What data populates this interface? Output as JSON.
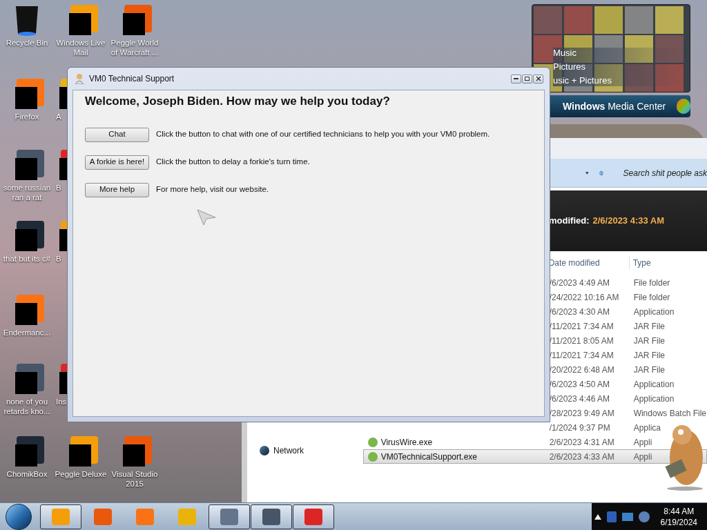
{
  "desktop_icons": [
    [
      {
        "label": "Recycle Bin",
        "redacted": false
      },
      {
        "label": "Windows Live Mail",
        "redacted": true
      },
      {
        "label": "Peggle World of Warcraft ...",
        "redacted": true
      }
    ],
    [
      {
        "label": "Firefox",
        "redacted": true
      },
      {
        "label": "A",
        "redacted": true
      }
    ],
    [
      {
        "label": "some russian ran a rat",
        "redacted": true
      },
      {
        "label": "B",
        "redacted": true
      }
    ],
    [
      {
        "label": "that but its c#",
        "redacted": true
      },
      {
        "label": "B",
        "redacted": true
      }
    ],
    [
      {
        "label": "Endermanc...",
        "redacted": true
      }
    ],
    [
      {
        "label": "none of you retards kno...",
        "redacted": true
      },
      {
        "label": "Ins",
        "redacted": true
      }
    ],
    [
      {
        "label": "ChomikBox",
        "redacted": true
      },
      {
        "label": "Peggle Deluxe",
        "redacted": true
      },
      {
        "label": "Visual Studio 2015",
        "redacted": true
      }
    ]
  ],
  "media_center": {
    "items": [
      "Music",
      "Pictures",
      "usic + Pictures"
    ],
    "brand": "**Windows** Media Center"
  },
  "explorer": {
    "search_placeholder": "Search shit people ask",
    "details": {
      "label": "modified:",
      "value": "2/6/2023 4:33 AM"
    },
    "nav_items": [
      "Network"
    ],
    "columns": [
      "Date modified",
      "Type"
    ],
    "rows": [
      {
        "date": "/6/2023 4:49 AM",
        "type": "File folder",
        "selected": false
      },
      {
        "date": "/24/2022 10:16 AM",
        "type": "File folder",
        "selected": false
      },
      {
        "date": "/6/2023 4:30 AM",
        "type": "Application",
        "selected": false
      },
      {
        "date": "/11/2021 7:34 AM",
        "type": "JAR File",
        "selected": false
      },
      {
        "date": "/11/2021 8:05 AM",
        "type": "JAR File",
        "selected": false
      },
      {
        "date": "/11/2021 7:34 AM",
        "type": "JAR File",
        "selected": false
      },
      {
        "date": "/20/2022 6:48 AM",
        "type": "JAR File",
        "selected": false
      },
      {
        "date": "/6/2023 4:50 AM",
        "type": "Application",
        "selected": false
      },
      {
        "date": "/6/2023 4:46 AM",
        "type": "Application",
        "selected": false
      },
      {
        "date": "/28/2023 9:49 AM",
        "type": "Windows Batch File",
        "selected": false
      },
      {
        "date": "/1/2024 9:37 PM",
        "type": "Applica",
        "selected": false
      },
      {
        "name": "VirusWire.exe",
        "date": "2/6/2023 4:31 AM",
        "type": "Appli",
        "selected": false
      },
      {
        "name": "VM0TechnicalSupport.exe",
        "date": "2/6/2023 4:33 AM",
        "type": "Appli",
        "selected": true
      }
    ]
  },
  "window": {
    "title": "VM0 Technical Support",
    "heading": "Welcome, Joseph Biden. How may we help you today?",
    "options": [
      {
        "button": "Chat",
        "description": "Click the button to chat with one of our certified technicians to help you with your VM0 problem."
      },
      {
        "button": "A forkie is here!",
        "description": "Click the button to delay a forkie's turn time."
      },
      {
        "button": "More help",
        "description": "For more help, visit our website."
      }
    ]
  },
  "taskbar": {
    "items": [
      {
        "open": true
      },
      {
        "open": false
      },
      {
        "open": false
      },
      {
        "open": false
      },
      {
        "open": true
      },
      {
        "open": true
      },
      {
        "open": true
      }
    ],
    "time": "8:44 AM",
    "date": "6/19/2024"
  }
}
